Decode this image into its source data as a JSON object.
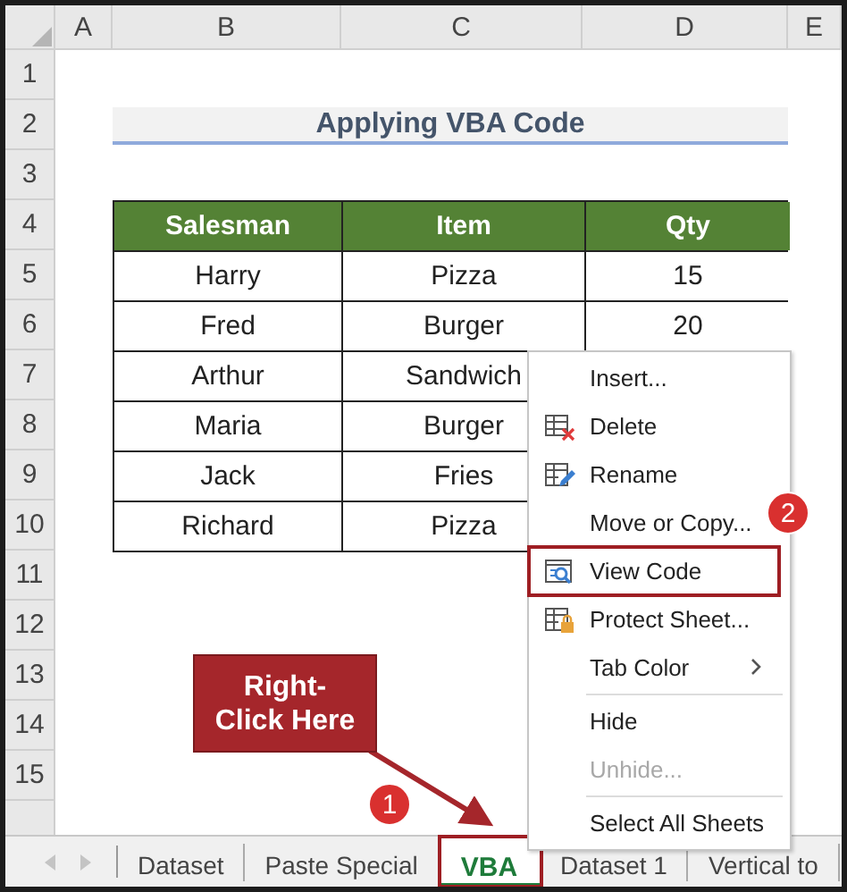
{
  "sheet": {
    "columns": [
      "A",
      "B",
      "C",
      "D",
      "E"
    ],
    "rows": [
      "1",
      "2",
      "3",
      "4",
      "5",
      "6",
      "7",
      "8",
      "9",
      "10",
      "11",
      "12",
      "13",
      "14",
      "15"
    ],
    "title": "Applying VBA Code",
    "table": {
      "columns": [
        "Salesman",
        "Item",
        "Qty"
      ],
      "rows": [
        [
          "Harry",
          "Pizza",
          "15"
        ],
        [
          "Fred",
          "Burger",
          "20"
        ],
        [
          "Arthur",
          "Sandwich"
        ],
        [
          "Maria",
          "Burger"
        ],
        [
          "Jack",
          "Fries"
        ],
        [
          "Richard",
          "Pizza"
        ]
      ]
    }
  },
  "context_menu": {
    "badge": "2",
    "items": [
      {
        "kind": "item",
        "label": "Insert...",
        "disabled": false,
        "highlighted": false,
        "submenu": false
      },
      {
        "kind": "item",
        "label": "Delete",
        "disabled": false,
        "highlighted": false,
        "submenu": false
      },
      {
        "kind": "item",
        "label": "Rename",
        "disabled": false,
        "highlighted": false,
        "submenu": false
      },
      {
        "kind": "item",
        "label": "Move or Copy...",
        "disabled": false,
        "highlighted": false,
        "submenu": false
      },
      {
        "kind": "item",
        "label": "View Code",
        "disabled": false,
        "highlighted": true,
        "submenu": false
      },
      {
        "kind": "item",
        "label": "Protect Sheet...",
        "disabled": false,
        "highlighted": false,
        "submenu": false
      },
      {
        "kind": "item",
        "label": "Tab Color",
        "disabled": false,
        "highlighted": false,
        "submenu": true
      },
      {
        "kind": "separator"
      },
      {
        "kind": "item",
        "label": "Hide",
        "disabled": false,
        "highlighted": false,
        "submenu": false
      },
      {
        "kind": "item",
        "label": "Unhide...",
        "disabled": true,
        "highlighted": false,
        "submenu": false
      },
      {
        "kind": "separator"
      },
      {
        "kind": "item",
        "label": "Select All Sheets",
        "disabled": false,
        "highlighted": false,
        "submenu": false
      }
    ]
  },
  "sheet_tabs": [
    {
      "label": "Dataset",
      "selected": false,
      "highlighted": false
    },
    {
      "label": "Paste Special",
      "selected": false,
      "highlighted": false
    },
    {
      "label": "VBA",
      "selected": true,
      "highlighted": true
    },
    {
      "label": "Dataset 1",
      "selected": false,
      "highlighted": false
    },
    {
      "label": "Vertical to",
      "selected": false,
      "highlighted": false
    }
  ],
  "callout": {
    "text": "Right-Click Here",
    "badge": "1"
  }
}
